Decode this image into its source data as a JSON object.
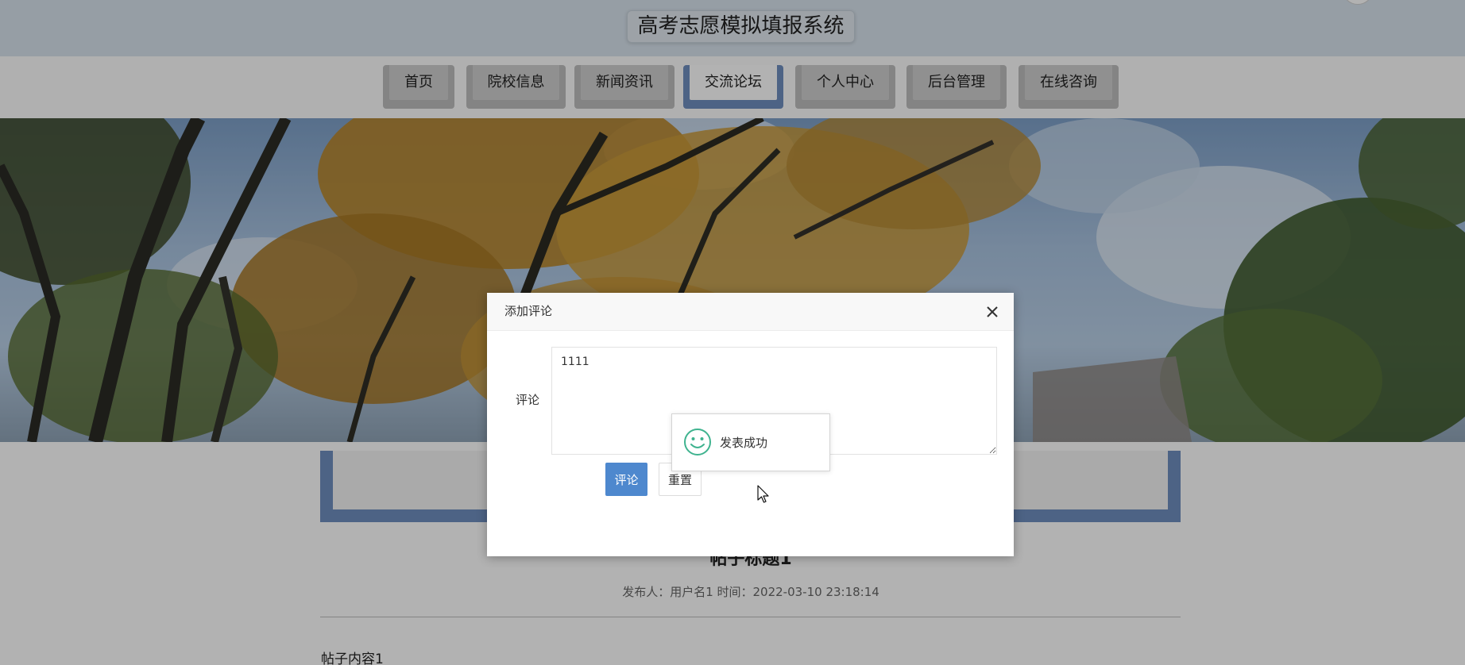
{
  "header": {
    "site_title": "高考志愿模拟填报系统"
  },
  "nav": {
    "active_index": 3,
    "items": [
      {
        "label": "首页"
      },
      {
        "label": "院校信息"
      },
      {
        "label": "新闻资讯"
      },
      {
        "label": "交流论坛"
      },
      {
        "label": "个人中心"
      },
      {
        "label": "后台管理"
      },
      {
        "label": "在线咨询"
      }
    ]
  },
  "post": {
    "title": "帖子标题1",
    "meta": "发布人：用户名1 时间：2022-03-10 23:18:14",
    "content": "帖子内容1"
  },
  "dialog": {
    "title": "添加评论",
    "close_icon": "close-icon",
    "field_label": "评论",
    "comment_value": "1111",
    "submit_label": "评论",
    "reset_label": "重置"
  },
  "toast": {
    "icon": "smile-icon",
    "message": "发表成功",
    "color": "#3fb38f"
  },
  "colors": {
    "header_bg": "#d7e2ec",
    "nav_active": "#6f8fbf",
    "primary_button": "#4e88ce"
  }
}
